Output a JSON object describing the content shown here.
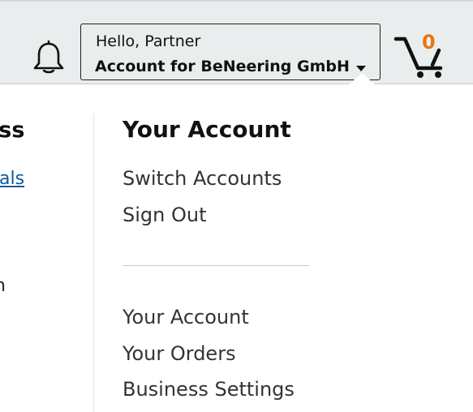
{
  "header": {
    "greeting": "Hello, Partner",
    "account_name": "Account for BeNeering GmbH",
    "cart_count": "0",
    "bell_icon": "bell-icon",
    "cart_icon": "cart-icon",
    "caret_icon": "caret-down-icon"
  },
  "left_panel": {
    "heading_fragment": "ess",
    "link_fragment": "vals",
    "text_fragment": "n"
  },
  "flyout": {
    "heading": "Your Account",
    "group1": [
      "Switch Accounts",
      "Sign Out"
    ],
    "group2": [
      "Your Account",
      "Your Orders",
      "Business Settings"
    ]
  },
  "colors": {
    "header_bg": "#eaeded",
    "cart_count": "#e47911",
    "link": "#0b5aa0"
  }
}
